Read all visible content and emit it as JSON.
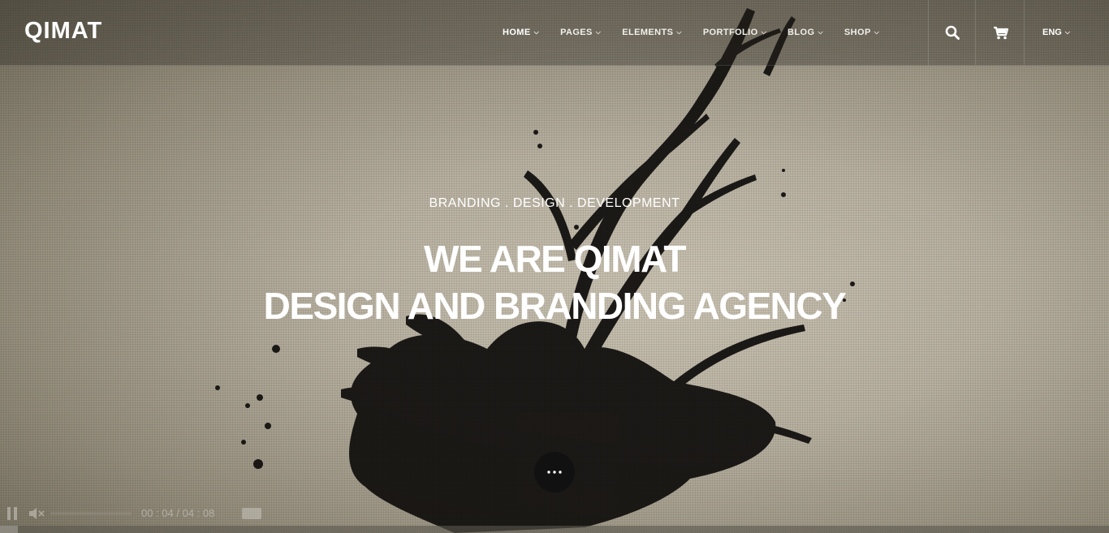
{
  "header": {
    "logo": "QIMAT",
    "nav": [
      {
        "label": "HOME",
        "active": true
      },
      {
        "label": "PAGES",
        "active": false
      },
      {
        "label": "ELEMENTS",
        "active": false
      },
      {
        "label": "PORTFOLIO",
        "active": false
      },
      {
        "label": "BLOG",
        "active": false
      },
      {
        "label": "SHOP",
        "active": false
      }
    ],
    "search_icon": "search-icon",
    "cart_icon": "cart-icon",
    "language": "ENG"
  },
  "hero": {
    "subtitle": "BRANDING . DESIGN . DEVELOPMENT",
    "title_line1": "WE ARE QIMAT",
    "title_line2": "DESIGN AND BRANDING AGENCY",
    "more_icon": "ellipsis-icon"
  },
  "video": {
    "current_time": "00 : 04",
    "duration": "04 : 08",
    "time_display": "00 : 04 / 04 : 08",
    "progress_fraction": 0.016
  },
  "colors": {
    "text": "#ffffff",
    "button_bg": "#111111",
    "ink": "#141210"
  }
}
